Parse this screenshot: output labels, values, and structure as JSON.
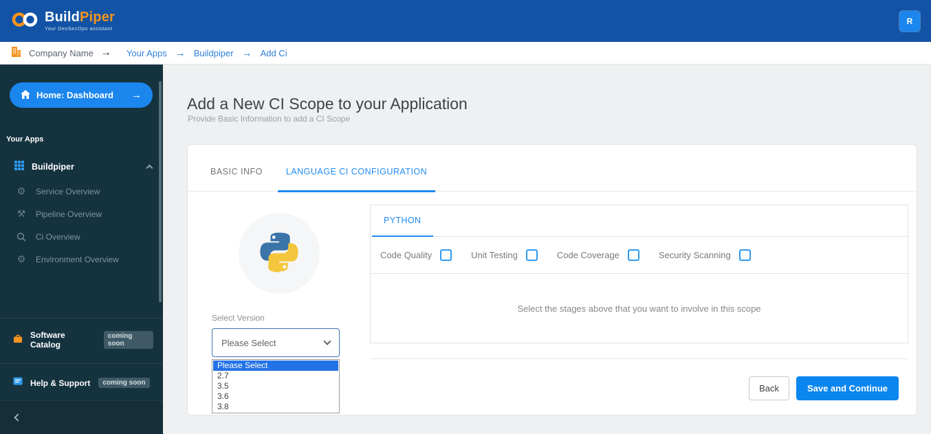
{
  "header": {
    "brand_build": "Build",
    "brand_piper": "Piper",
    "tagline": "Your DevSecOps assistant",
    "avatar": "R"
  },
  "breadcrumb": {
    "company": "Company Name",
    "items": [
      {
        "label": "Your Apps"
      },
      {
        "label": "Buildpiper"
      },
      {
        "label": "Add Ci"
      }
    ]
  },
  "sidebar": {
    "home_label": "Home: Dashboard",
    "section_label": "Your Apps",
    "app_label": "Buildpiper",
    "items": [
      {
        "label": "Service Overview",
        "icon": "gear-icon"
      },
      {
        "label": "Pipeline Overview",
        "icon": "tools-icon"
      },
      {
        "label": "Ci Overview",
        "icon": "search-icon"
      },
      {
        "label": "Environment Overview",
        "icon": "gear-icon"
      }
    ],
    "catalog_label": "Software Catalog",
    "help_label": "Help & Support",
    "coming_soon": "coming soon"
  },
  "page": {
    "title": "Add a New CI Scope to your Application",
    "subtitle": "Provide Basic Information to add a CI Scope"
  },
  "card": {
    "tabs": [
      {
        "label": "BASIC INFO",
        "active": false
      },
      {
        "label": "LANGUAGE CI CONFIGURATION",
        "active": true
      }
    ],
    "language_tab": "PYTHON",
    "language_logo": "python-logo",
    "stages": [
      {
        "label": "Code Quality",
        "checked": false
      },
      {
        "label": "Unit Testing",
        "checked": false
      },
      {
        "label": "Code Coverage",
        "checked": false
      },
      {
        "label": "Security Scanning",
        "checked": false
      }
    ],
    "stage_hint": "Select the stages above that you want to involve in this scope",
    "version": {
      "label": "Select Version",
      "value": "Please Select",
      "options": [
        "Please Select",
        "2.7",
        "3.5",
        "3.6",
        "3.8"
      ],
      "highlighted_option": "Please Select"
    },
    "actions": {
      "back": "Back",
      "save": "Save and Continue"
    }
  },
  "colors": {
    "header_blue": "#1253a5",
    "sidebar_bg": "#15323f",
    "accent_blue": "#1f8af0",
    "brand_orange": "#f7941e"
  }
}
